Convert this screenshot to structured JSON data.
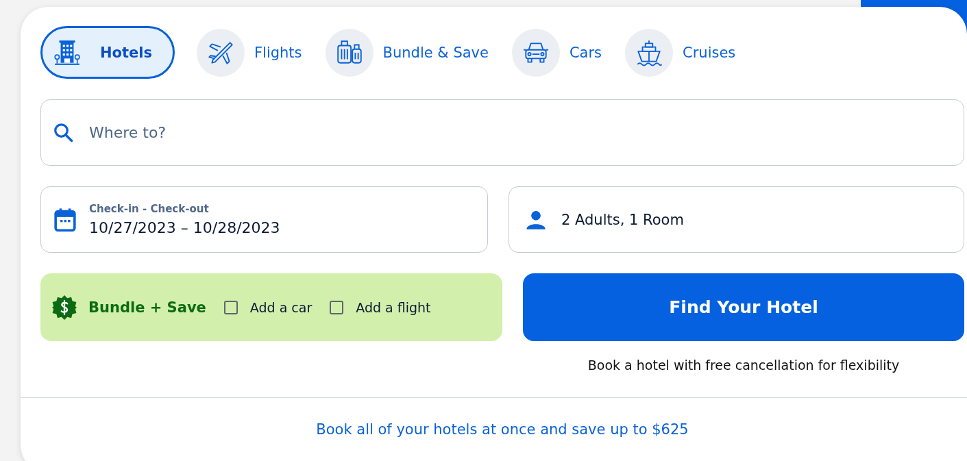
{
  "tabs": [
    {
      "label": "Hotels",
      "kind": "hotel",
      "selected": true
    },
    {
      "label": "Flights",
      "kind": "plane",
      "selected": false
    },
    {
      "label": "Bundle & Save",
      "kind": "luggage",
      "selected": false
    },
    {
      "label": "Cars",
      "kind": "car",
      "selected": false
    },
    {
      "label": "Cruises",
      "kind": "ship",
      "selected": false
    }
  ],
  "search": {
    "placeholder": "Where to?"
  },
  "dates": {
    "label": "Check-in - Check-out",
    "value": "10/27/2023 – 10/28/2023"
  },
  "guests": {
    "value": "2 Adults, 1 Room"
  },
  "bundle": {
    "title": "Bundle + Save",
    "options": [
      {
        "label": "Add a car",
        "checked": false
      },
      {
        "label": "Add a flight",
        "checked": false
      }
    ]
  },
  "submit": {
    "label": "Find Your Hotel"
  },
  "caption": "Book a hotel with free cancellation for flexibility",
  "footer_link": "Book all of your hotels at once and save up to $625"
}
